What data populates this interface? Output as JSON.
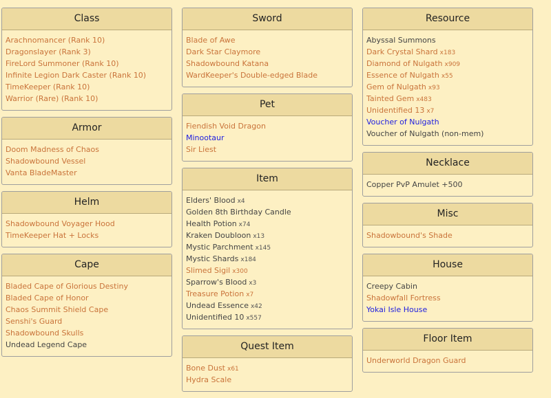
{
  "columns": [
    [
      {
        "title": "Class",
        "items": [
          {
            "name": "Arachnomancer (Rank 10)",
            "color": "orange"
          },
          {
            "name": "Dragonslayer (Rank 3)",
            "color": "orange"
          },
          {
            "name": "FireLord Summoner (Rank 10)",
            "color": "orange"
          },
          {
            "name": "Infinite Legion Dark Caster (Rank 10)",
            "color": "orange"
          },
          {
            "name": "TimeKeeper (Rank 10)",
            "color": "orange"
          },
          {
            "name": "Warrior (Rare) (Rank 10)",
            "color": "orange"
          }
        ]
      },
      {
        "title": "Armor",
        "items": [
          {
            "name": "Doom Madness of Chaos",
            "color": "orange"
          },
          {
            "name": "Shadowbound Vessel",
            "color": "orange"
          },
          {
            "name": "Vanta BladeMaster",
            "color": "orange"
          }
        ]
      },
      {
        "title": "Helm",
        "items": [
          {
            "name": "Shadowbound Voyager Hood",
            "color": "orange"
          },
          {
            "name": "TimeKeeper Hat + Locks",
            "color": "orange"
          }
        ]
      },
      {
        "title": "Cape",
        "items": [
          {
            "name": "Bladed Cape of Glorious Destiny",
            "color": "orange"
          },
          {
            "name": "Bladed Cape of Honor",
            "color": "orange"
          },
          {
            "name": "Chaos Summit Shield Cape",
            "color": "orange"
          },
          {
            "name": "Senshi's Guard",
            "color": "orange"
          },
          {
            "name": "Shadowbound Skulls",
            "color": "orange"
          },
          {
            "name": "Undead Legend Cape",
            "color": "grey"
          }
        ]
      }
    ],
    [
      {
        "title": "Sword",
        "items": [
          {
            "name": "Blade of Awe",
            "color": "orange"
          },
          {
            "name": "Dark Star Claymore",
            "color": "orange"
          },
          {
            "name": "Shadowbound Katana",
            "color": "orange"
          },
          {
            "name": "WardKeeper's Double-edged Blade",
            "color": "orange"
          }
        ]
      },
      {
        "title": "Pet",
        "items": [
          {
            "name": "Fiendish Void Dragon",
            "color": "orange"
          },
          {
            "name": "Minootaur",
            "color": "blue"
          },
          {
            "name": "Sir Liest",
            "color": "orange"
          }
        ]
      },
      {
        "title": "Item",
        "items": [
          {
            "name": "Elders' Blood",
            "qty": "x4",
            "color": "grey"
          },
          {
            "name": "Golden 8th Birthday Candle",
            "color": "grey"
          },
          {
            "name": "Health Potion",
            "qty": "x74",
            "color": "grey"
          },
          {
            "name": "Kraken Doubloon",
            "qty": "x13",
            "color": "grey"
          },
          {
            "name": "Mystic Parchment",
            "qty": "x145",
            "color": "grey"
          },
          {
            "name": "Mystic Shards",
            "qty": "x184",
            "color": "grey"
          },
          {
            "name": "Slimed Sigil",
            "qty": "x300",
            "color": "orange"
          },
          {
            "name": "Sparrow's Blood",
            "qty": "x3",
            "color": "grey"
          },
          {
            "name": "Treasure Potion",
            "qty": "x7",
            "color": "orange"
          },
          {
            "name": "Undead Essence",
            "qty": "x42",
            "color": "grey"
          },
          {
            "name": "Unidentified 10",
            "qty": "x557",
            "color": "grey"
          }
        ]
      },
      {
        "title": "Quest Item",
        "items": [
          {
            "name": "Bone Dust",
            "qty": "x61",
            "color": "orange"
          },
          {
            "name": "Hydra Scale",
            "color": "orange"
          }
        ]
      }
    ],
    [
      {
        "title": "Resource",
        "items": [
          {
            "name": "Abyssal Summons",
            "color": "grey"
          },
          {
            "name": "Dark Crystal Shard",
            "qty": "x183",
            "color": "orange"
          },
          {
            "name": "Diamond of Nulgath",
            "qty": "x909",
            "color": "orange"
          },
          {
            "name": "Essence of Nulgath",
            "qty": "x55",
            "color": "orange"
          },
          {
            "name": "Gem of Nulgath",
            "qty": "x93",
            "color": "orange"
          },
          {
            "name": "Tainted Gem",
            "qty": "x483",
            "color": "orange"
          },
          {
            "name": "Unidentified 13",
            "qty": "x7",
            "color": "orange"
          },
          {
            "name": "Voucher of Nulgath",
            "color": "blue"
          },
          {
            "name": "Voucher of Nulgath (non-mem)",
            "color": "grey"
          }
        ]
      },
      {
        "title": "Necklace",
        "items": [
          {
            "name": "Copper PvP Amulet +500",
            "color": "grey"
          }
        ]
      },
      {
        "title": "Misc",
        "items": [
          {
            "name": "Shadowbound's Shade",
            "color": "orange"
          }
        ]
      },
      {
        "title": "House",
        "items": [
          {
            "name": "Creepy Cabin",
            "color": "grey"
          },
          {
            "name": "Shadowfall Fortress",
            "color": "orange"
          },
          {
            "name": "Yokai Isle House",
            "color": "blue"
          }
        ]
      },
      {
        "title": "Floor Item",
        "items": [
          {
            "name": "Underworld Dragon Guard",
            "color": "orange"
          }
        ]
      }
    ]
  ],
  "colors": {
    "orange": "#c9733a",
    "blue": "#1d1de0",
    "grey": "#444444",
    "background": "#fdf0c3",
    "header": "#eddaa0"
  }
}
